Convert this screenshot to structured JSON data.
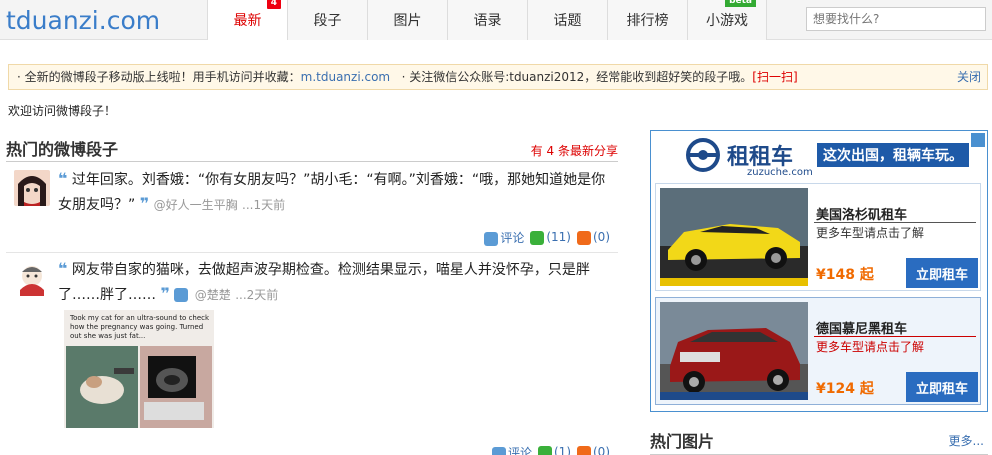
{
  "header": {
    "logo": "tduanzi.com",
    "nav": [
      {
        "label": "最新",
        "badge": "4"
      },
      {
        "label": "段子"
      },
      {
        "label": "图片"
      },
      {
        "label": "语录"
      },
      {
        "label": "话题"
      },
      {
        "label": "排行榜"
      },
      {
        "label": "小游戏",
        "badge": "beta"
      }
    ],
    "search_placeholder": "想要找什么?"
  },
  "notice": {
    "text1": "· 全新的微博段子移动版上线啦！用手机访问并收藏：",
    "link1": "m.tduanzi.com",
    "text2": "· 关注微信公众账号:tduanzi2012，经常能收到超好笑的段子哦。",
    "link2": "[扫一扫]",
    "close": "关闭"
  },
  "welcome": "欢迎访问微博段子！",
  "section": {
    "title": "热门的微博段子",
    "new_count": "有 4 条最新分享"
  },
  "posts": [
    {
      "text": "过年回家。刘香娥：“你有女朋友吗？”胡小毛：“有啊。”刘香娥：“哦，那她知道她是你女朋友吗？”",
      "author": "@好人一生平胸",
      "time": "...1天前",
      "comment": "评论",
      "likes": "(11)",
      "shares": "(0)"
    },
    {
      "text": "网友带自家的猫咪，去做超声波孕期检查。检测结果显示，喵星人并没怀孕，只是胖了……胖了……",
      "author": "@楚楚",
      "time": "...2天前",
      "image_caption": "Took my cat for an ultra-sound to check how the pregnancy was going. Turned out she was just fat...",
      "comment": "评论",
      "likes": "(1)",
      "shares": "(0)"
    }
  ],
  "ad": {
    "brand": "租租车",
    "domain": "zuzuche.com",
    "slogan": "这次出国，租辆车玩。",
    "cards": [
      {
        "title": "美国洛杉矶租车",
        "sub": "更多车型请点击了解",
        "price": "¥148 起",
        "button": "立即租车"
      },
      {
        "title": "德国慕尼黑租车",
        "sub": "更多车型请点击了解",
        "price": "¥124 起",
        "button": "立即租车"
      }
    ]
  },
  "sidebar": {
    "title": "热门图片",
    "more": "更多..."
  }
}
